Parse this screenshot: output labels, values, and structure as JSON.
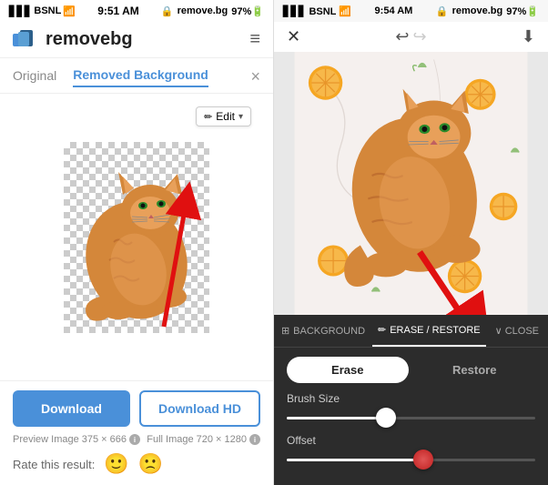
{
  "left": {
    "status": {
      "carrier": "BSNL",
      "time": "9:51 AM",
      "battery": "97%",
      "url": "remove.bg"
    },
    "logo": "removebg",
    "nav": {
      "hamburger": "≡"
    },
    "tabs": [
      {
        "label": "Original",
        "active": false
      },
      {
        "label": "Removed Background",
        "active": true
      }
    ],
    "edit_button": "✏ Edit",
    "buttons": {
      "download": "Download",
      "download_hd": "Download HD"
    },
    "preview_label": "Preview Image",
    "preview_size": "375 × 666",
    "full_label": "Full Image",
    "full_size": "720 × 1280",
    "rate_label": "Rate this result:"
  },
  "right": {
    "status": {
      "carrier": "BSNL",
      "time": "9:54 AM",
      "battery": "97%",
      "url": "remove.bg"
    },
    "toolbar": {
      "tabs": [
        {
          "label": "BACKGROUND",
          "icon": "layers",
          "active": false
        },
        {
          "label": "ERASE / RESTORE",
          "icon": "pencil",
          "active": true
        }
      ],
      "close": "CLOSE"
    },
    "erase_btn": "Erase",
    "restore_btn": "Restore",
    "brush_size_label": "Brush Size",
    "brush_size_value": 40,
    "offset_label": "Offset",
    "offset_value": 55
  }
}
